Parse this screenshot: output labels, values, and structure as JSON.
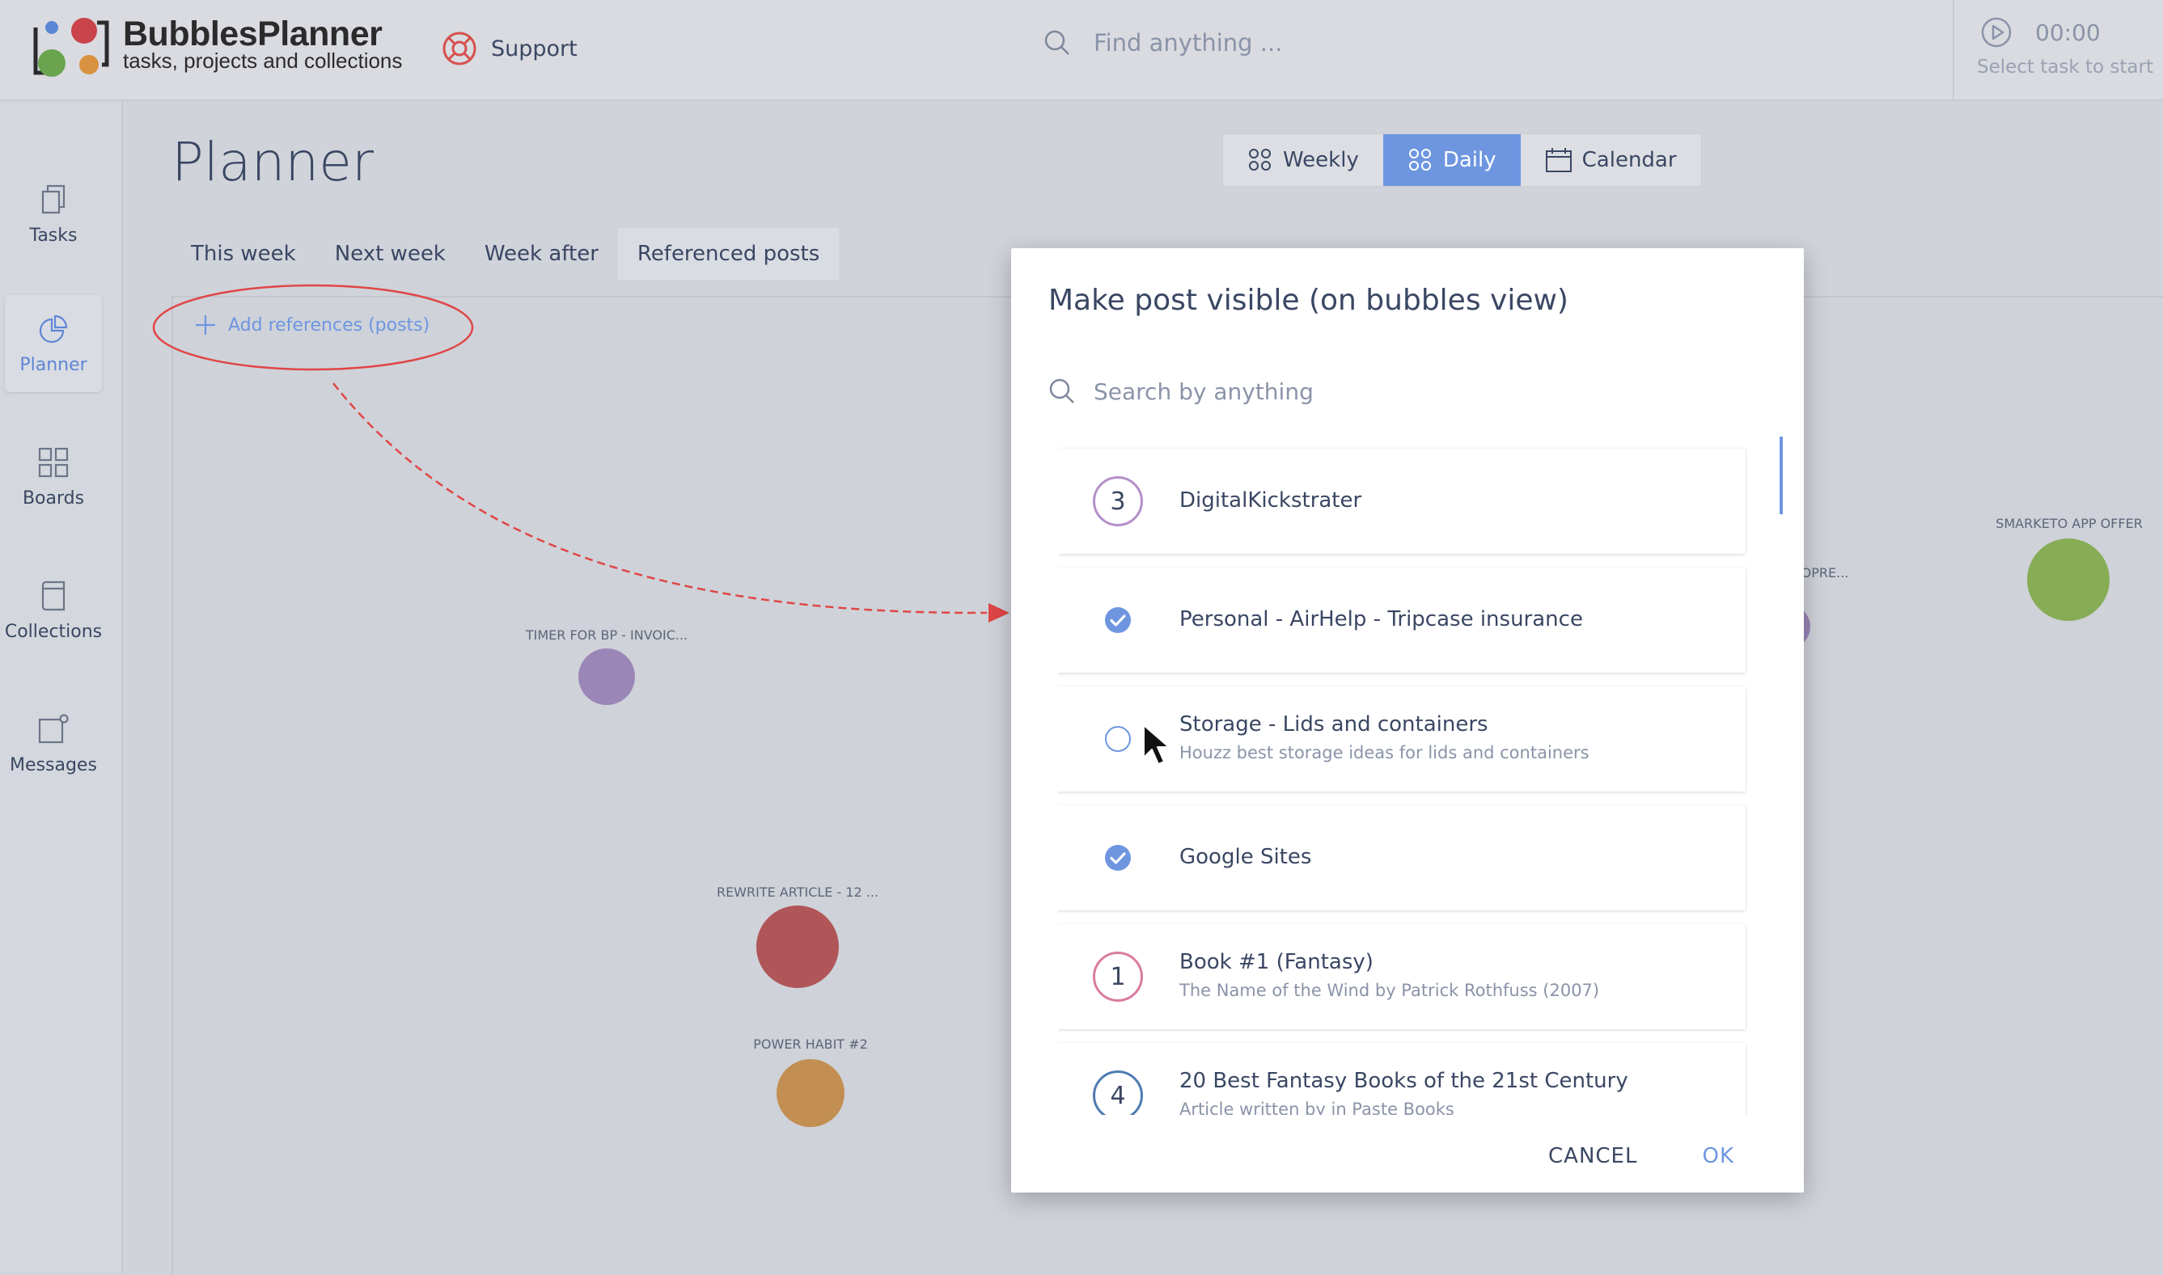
{
  "brand": {
    "name": "BubblesPlanner",
    "tagline": "tasks, projects and collections"
  },
  "header": {
    "support_label": "Support",
    "search_placeholder": "Find anything ...",
    "timer": {
      "time": "00:00",
      "hint": "Select task to start"
    }
  },
  "sidebar": {
    "items": [
      {
        "label": "Tasks",
        "icon": "copy-icon"
      },
      {
        "label": "Planner",
        "icon": "pie-chart-icon",
        "active": true
      },
      {
        "label": "Boards",
        "icon": "grid-icon"
      },
      {
        "label": "Collections",
        "icon": "book-icon"
      },
      {
        "label": "Messages",
        "icon": "message-icon"
      }
    ]
  },
  "page": {
    "title": "Planner",
    "views": [
      {
        "label": "Weekly"
      },
      {
        "label": "Daily",
        "active": true
      },
      {
        "label": "Calendar"
      }
    ],
    "tabs": [
      {
        "label": "This week"
      },
      {
        "label": "Next week"
      },
      {
        "label": "Week after"
      },
      {
        "label": "Referenced posts",
        "active": true
      }
    ],
    "add_references_label": "Add references (posts)"
  },
  "bubbles": [
    {
      "label": "TIMER FOR BP - INVOIC...",
      "color": "#9b86b8"
    },
    {
      "label": "REWRITE ARTICLE - 12 ...",
      "color": "#b05658"
    },
    {
      "label": "POWER HABIT #2",
      "color": "#c28e52"
    },
    {
      "label": "SMARKETO APP OFFER",
      "color": "#86ac55"
    },
    {
      "label": "OPRE...",
      "color": "#9b86b8"
    }
  ],
  "dialog": {
    "title": "Make post visible (on bubbles view)",
    "search_placeholder": "Search by anything",
    "items": [
      {
        "kind": "number",
        "number": "3",
        "ring": "#b48fc9",
        "title": "DigitalKickstrater",
        "subtitle": ""
      },
      {
        "kind": "checked",
        "title": "Personal - AirHelp - Tripcase insurance",
        "subtitle": ""
      },
      {
        "kind": "unchecked",
        "title": "Storage - Lids and containers",
        "subtitle": "Houzz best storage ideas for lids and containers"
      },
      {
        "kind": "checked",
        "title": "Google Sites",
        "subtitle": ""
      },
      {
        "kind": "number",
        "number": "1",
        "ring": "#d97ba0",
        "title": "Book #1 (Fantasy)",
        "subtitle": "The Name of the Wind by Patrick Rothfuss (2007)"
      },
      {
        "kind": "number",
        "number": "4",
        "ring": "#4d7bb0",
        "title": "20 Best Fantasy Books of the 21st Century",
        "subtitle": "Article written by in Paste Books"
      }
    ],
    "cancel_label": "CANCEL",
    "ok_label": "OK"
  },
  "colors": {
    "accent": "#6e96e0",
    "annotation": "#e04646",
    "text": "#3a4763"
  }
}
